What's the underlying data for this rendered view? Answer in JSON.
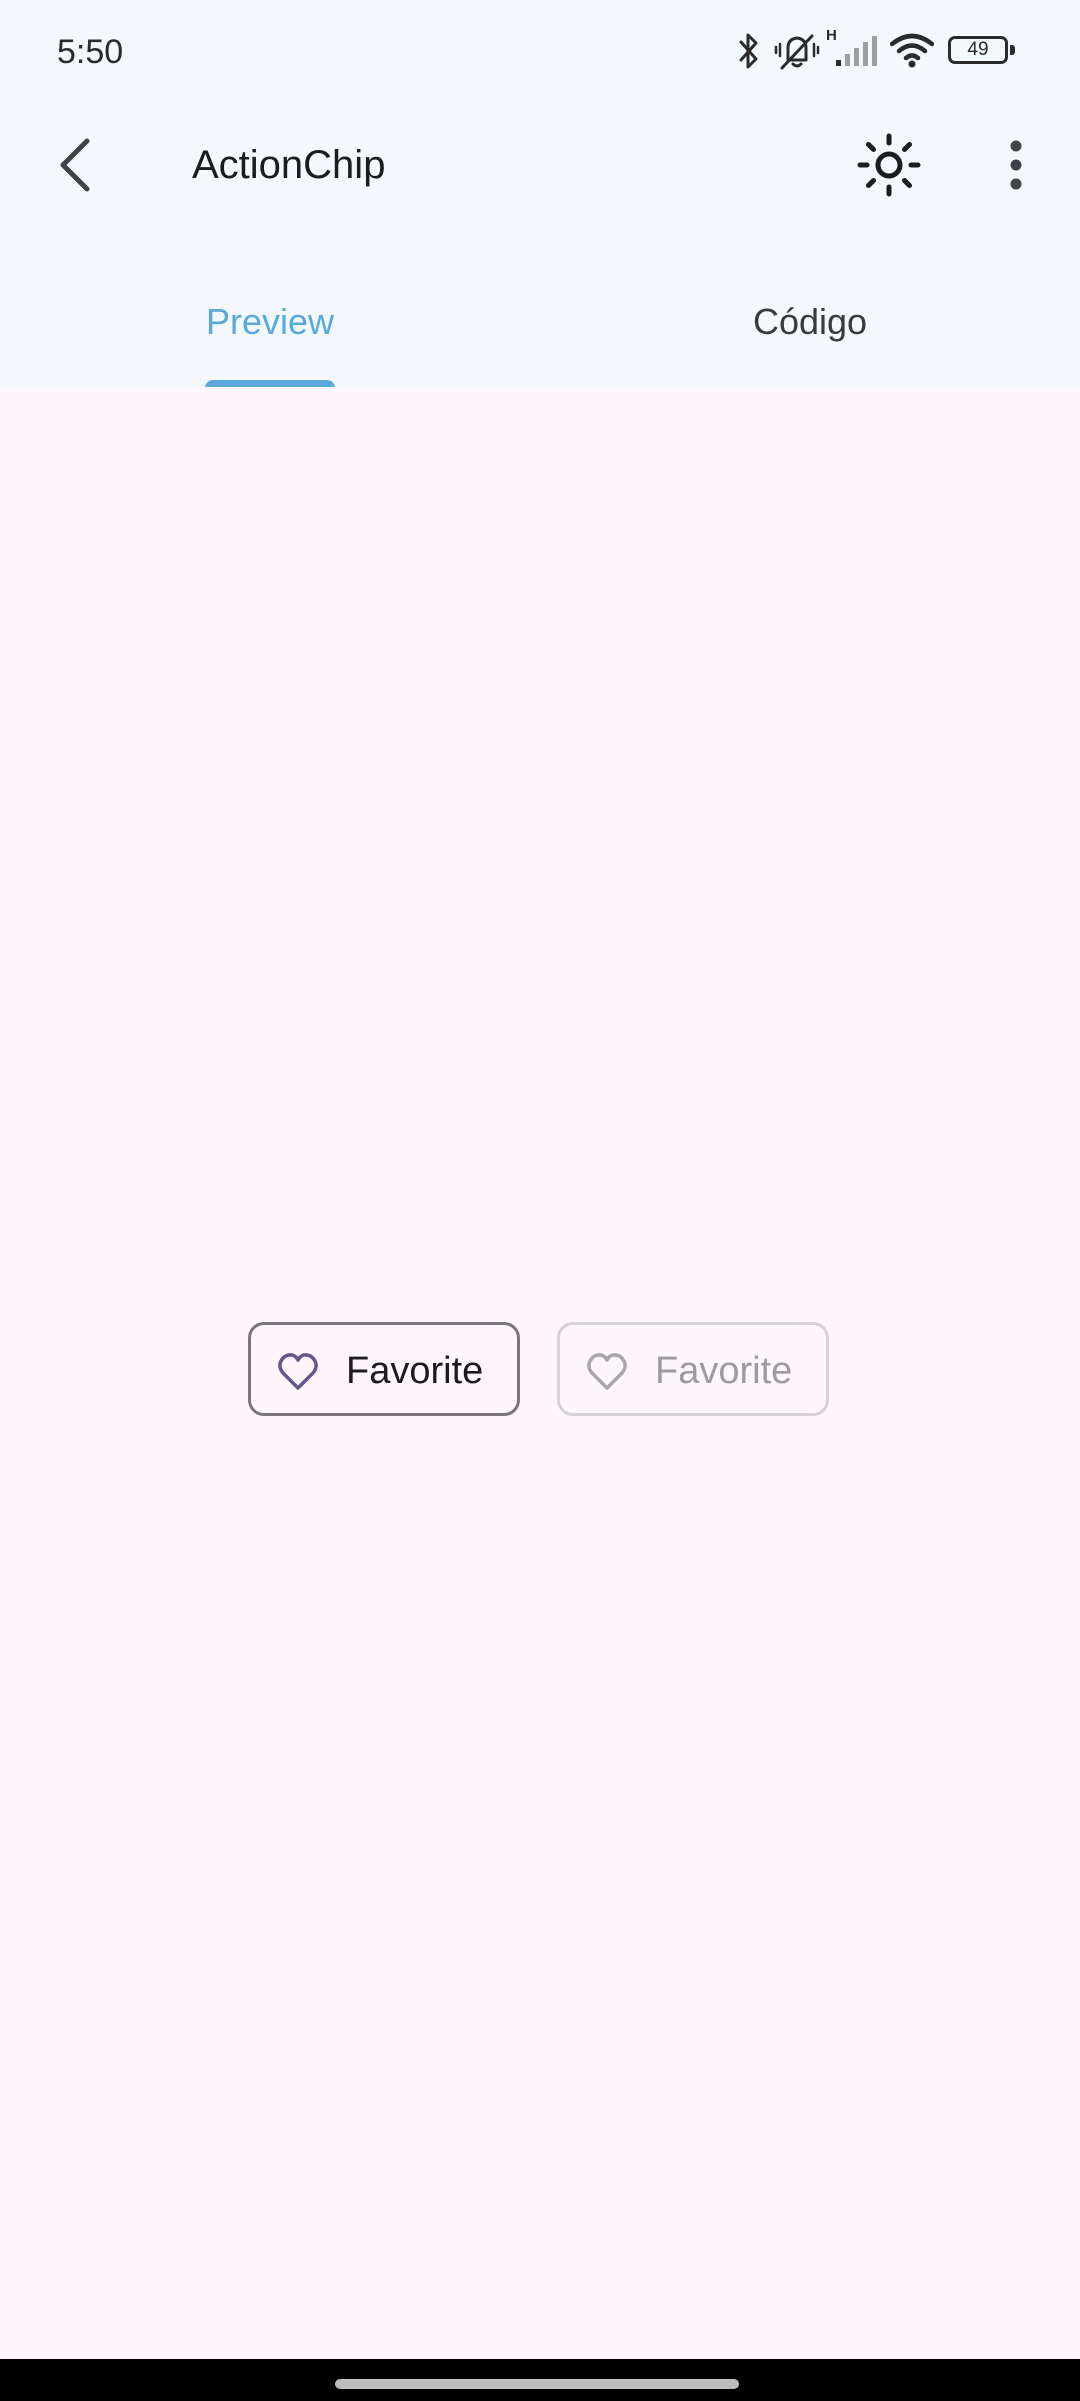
{
  "status_bar": {
    "time": "5:50",
    "battery_level": "49",
    "network_type": "H",
    "icons": [
      "bluetooth-icon",
      "vibrate-icon",
      "cell-signal-icon",
      "wifi-icon",
      "battery-icon"
    ]
  },
  "app_bar": {
    "title": "ActionChip",
    "icons": [
      "back-arrow-icon",
      "sun-icon",
      "more-vert-icon"
    ]
  },
  "tabs": [
    {
      "label": "Preview",
      "selected": true
    },
    {
      "label": "Código",
      "selected": false
    }
  ],
  "chips": [
    {
      "label": "Favorite",
      "icon": "heart-outline-icon",
      "enabled": true
    },
    {
      "label": "Favorite",
      "icon": "heart-outline-icon",
      "enabled": false
    }
  ],
  "colors": {
    "top_background": "#f3f8fc",
    "content_background": "#fdf7fd",
    "tab_accent": "#5aa9dc",
    "chip_icon_enabled": "#65558f",
    "chip_outline_enabled": "#79747e",
    "chip_outline_disabled": "#d6d0d8",
    "nav_bar": "#000000"
  }
}
